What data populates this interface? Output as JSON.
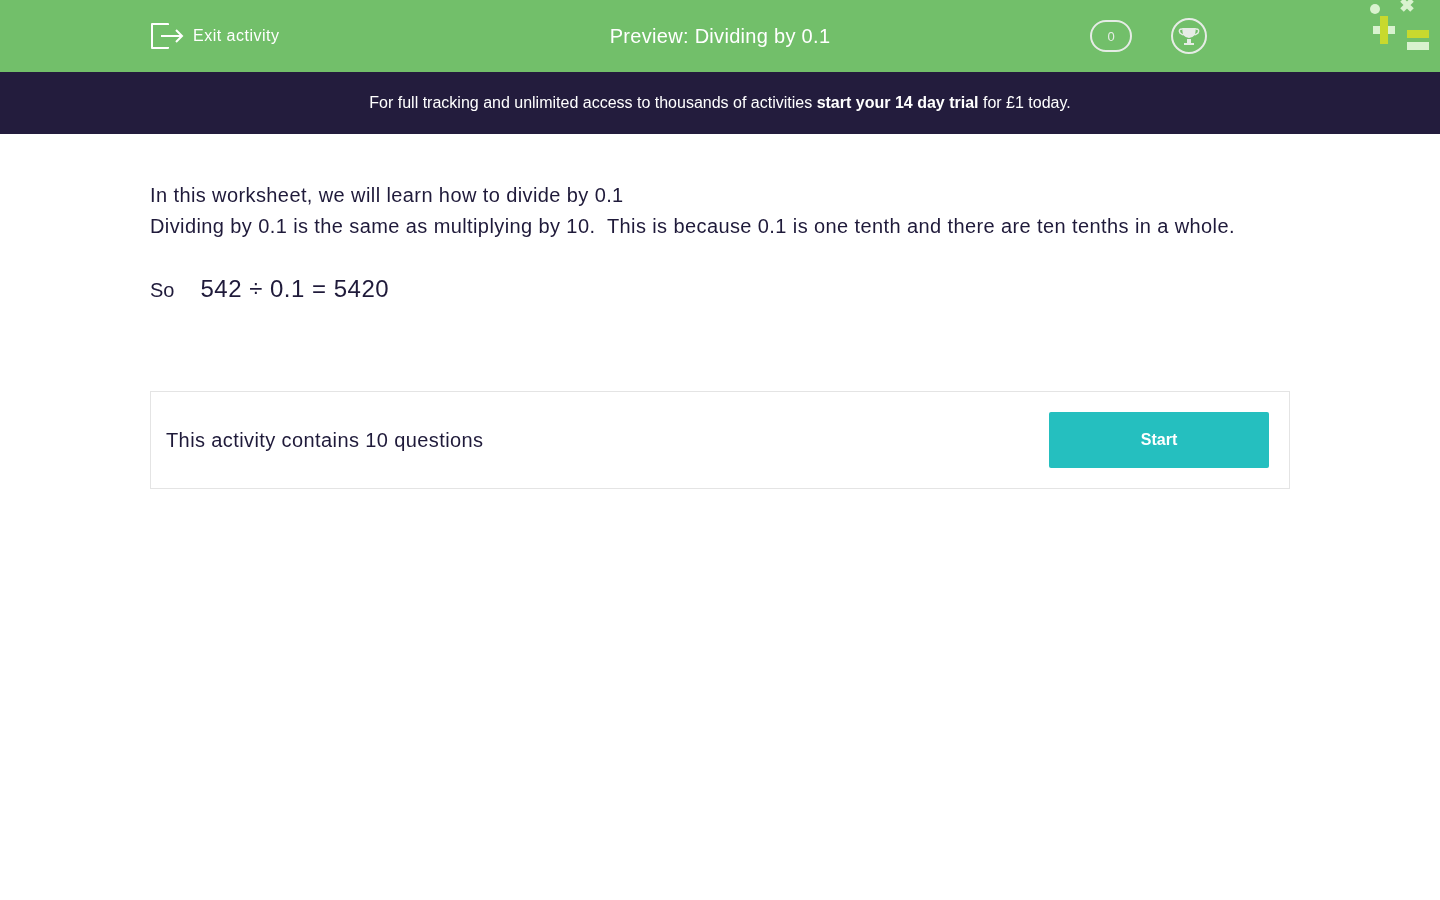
{
  "header": {
    "exit_label": "Exit activity",
    "title": "Preview: Dividing by 0.1",
    "score": "0"
  },
  "banner": {
    "text": "For full tracking and unlimited access to thousands of activities **start your 14 day trial** for £1 today."
  },
  "intro": {
    "lines": [
      "In this worksheet, we will learn how to divide by 0.1",
      "Dividing by 0.1 is the same as multiplying by 10.  This is because 0.1 is one tenth and there are ten tenths in a whole."
    ],
    "example_label": "So",
    "example": "542 ÷ 0.1 = 5420"
  },
  "activity": {
    "text": "This activity contains 10 questions",
    "button": "Start"
  }
}
